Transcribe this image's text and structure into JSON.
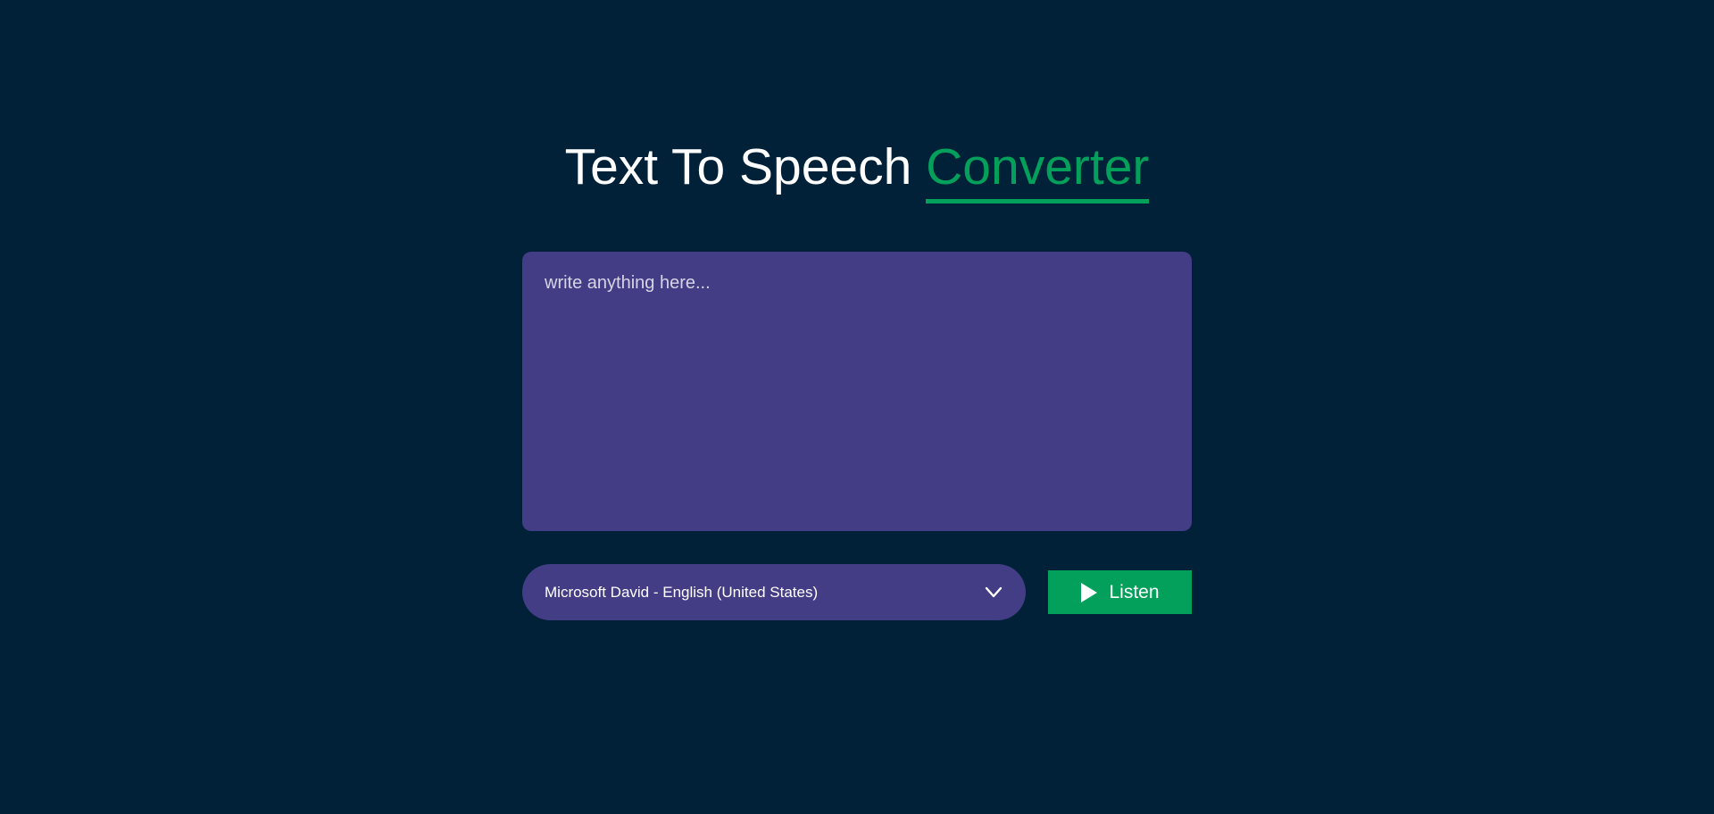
{
  "header": {
    "title_main": "Text To Speech",
    "title_accent": "Converter"
  },
  "editor": {
    "placeholder": "write anything here...",
    "value": ""
  },
  "voice_select": {
    "selected": "Microsoft David - English (United States)",
    "icon": "chevron-down-icon"
  },
  "listen_button": {
    "label": "Listen",
    "icon": "play-icon"
  },
  "colors": {
    "background": "#002138",
    "panel": "#423d85",
    "accent": "#02a05a",
    "text": "#ffffff"
  }
}
